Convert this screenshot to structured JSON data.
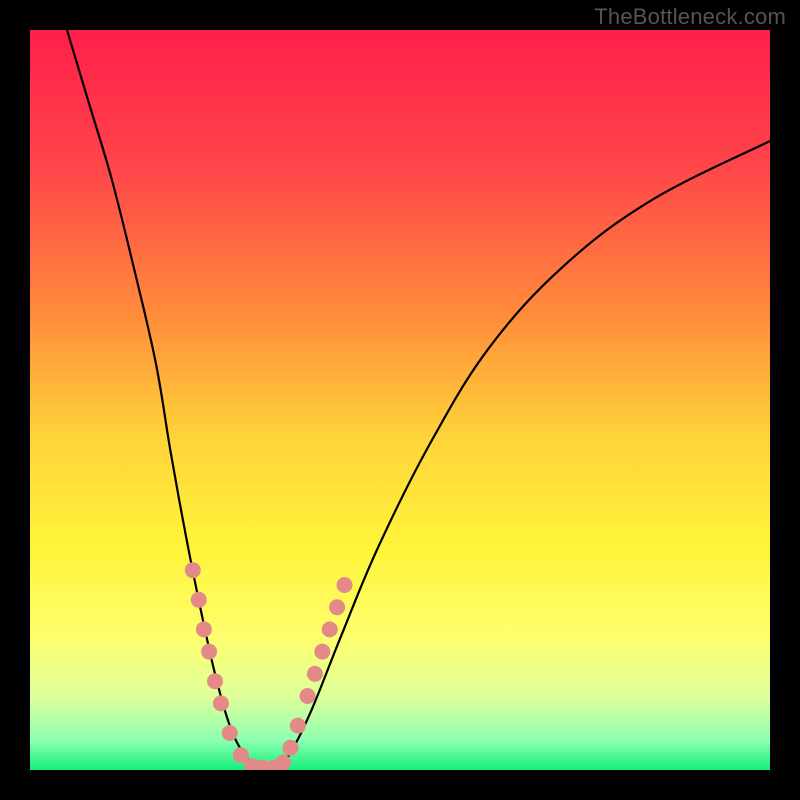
{
  "watermark": "TheBottleneck.com",
  "chart_data": {
    "type": "line",
    "title": "",
    "xlabel": "",
    "ylabel": "",
    "xlim": [
      0,
      100
    ],
    "ylim": [
      0,
      100
    ],
    "grid": false,
    "legend": false,
    "background": {
      "type": "vertical-gradient",
      "stops": [
        {
          "pos": 0.0,
          "color": "#ff1f4b"
        },
        {
          "pos": 0.18,
          "color": "#ff444a"
        },
        {
          "pos": 0.38,
          "color": "#ff8a3b"
        },
        {
          "pos": 0.55,
          "color": "#ffd33a"
        },
        {
          "pos": 0.7,
          "color": "#fff43a"
        },
        {
          "pos": 0.82,
          "color": "#fdff6e"
        },
        {
          "pos": 0.9,
          "color": "#e0ff9a"
        },
        {
          "pos": 0.96,
          "color": "#8dffb0"
        },
        {
          "pos": 1.0,
          "color": "#14f07a"
        }
      ]
    },
    "series": [
      {
        "name": "bottleneck-curve",
        "color": "#000000",
        "width": 2.2,
        "data": [
          {
            "x": 5,
            "y": 100
          },
          {
            "x": 8,
            "y": 90
          },
          {
            "x": 11,
            "y": 80
          },
          {
            "x": 14,
            "y": 68
          },
          {
            "x": 17,
            "y": 55
          },
          {
            "x": 19,
            "y": 43
          },
          {
            "x": 21,
            "y": 32
          },
          {
            "x": 23,
            "y": 22
          },
          {
            "x": 25,
            "y": 13
          },
          {
            "x": 27,
            "y": 6
          },
          {
            "x": 29,
            "y": 2
          },
          {
            "x": 31,
            "y": 0
          },
          {
            "x": 33,
            "y": 0
          },
          {
            "x": 35,
            "y": 2
          },
          {
            "x": 38,
            "y": 8
          },
          {
            "x": 42,
            "y": 18
          },
          {
            "x": 47,
            "y": 30
          },
          {
            "x": 54,
            "y": 44
          },
          {
            "x": 62,
            "y": 57
          },
          {
            "x": 72,
            "y": 68
          },
          {
            "x": 84,
            "y": 77
          },
          {
            "x": 100,
            "y": 85
          }
        ]
      }
    ],
    "markers": {
      "name": "sample-dots",
      "color": "#e38a88",
      "radius": 8,
      "data": [
        {
          "x": 22.0,
          "y": 27
        },
        {
          "x": 22.8,
          "y": 23
        },
        {
          "x": 23.5,
          "y": 19
        },
        {
          "x": 24.2,
          "y": 16
        },
        {
          "x": 25.0,
          "y": 12
        },
        {
          "x": 25.8,
          "y": 9
        },
        {
          "x": 27.0,
          "y": 5
        },
        {
          "x": 28.5,
          "y": 2
        },
        {
          "x": 30.0,
          "y": 0.5
        },
        {
          "x": 31.5,
          "y": 0.3
        },
        {
          "x": 33.0,
          "y": 0.3
        },
        {
          "x": 34.2,
          "y": 1
        },
        {
          "x": 35.2,
          "y": 3
        },
        {
          "x": 36.2,
          "y": 6
        },
        {
          "x": 37.5,
          "y": 10
        },
        {
          "x": 38.5,
          "y": 13
        },
        {
          "x": 39.5,
          "y": 16
        },
        {
          "x": 40.5,
          "y": 19
        },
        {
          "x": 41.5,
          "y": 22
        },
        {
          "x": 42.5,
          "y": 25
        }
      ]
    }
  }
}
